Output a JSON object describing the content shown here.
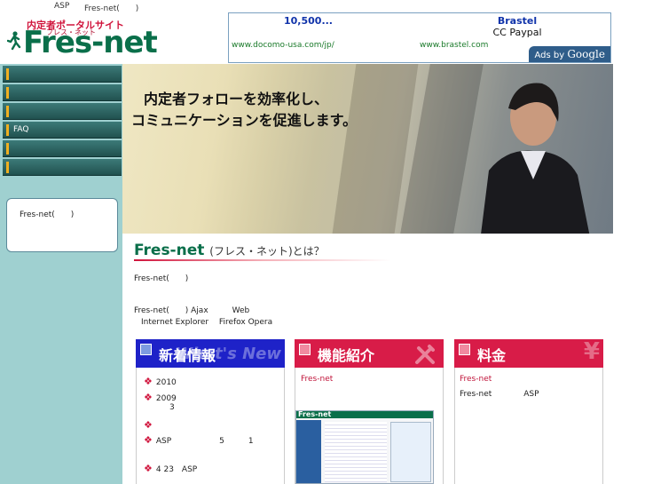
{
  "topbar": {
    "left": "ASP",
    "right": "Fres-net(　　)"
  },
  "logo": {
    "text": "Fres-net",
    "sub": "内定者ポータルサイト",
    "sub2": "フレス・ネット"
  },
  "ads": {
    "ad1": {
      "title": "10,500...",
      "desc": "",
      "url": "www.docomo-usa.com/jp/"
    },
    "ad2": {
      "title": "Brastel",
      "desc": "CC Paypal",
      "url": "www.brastel.com"
    },
    "adsby": "Ads by",
    "google": "Google"
  },
  "sidebar": {
    "items": [
      {
        "label": ""
      },
      {
        "label": ""
      },
      {
        "label": ""
      },
      {
        "label": "FAQ"
      },
      {
        "label": ""
      },
      {
        "label": ""
      }
    ],
    "box_text": "Fres-net(　　)"
  },
  "hero": {
    "line1": "内定者フォローを効率化し、",
    "line2": "コミュニケーションを促進します。"
  },
  "intro": {
    "title": "Fres-net",
    "title_jp": "(フレス・ネット)とは？",
    "p1": "Fres-net(　　)",
    "p2_line1": "Fres-net(　　) Ajax　　　Web",
    "p2_line2": "Internet Explorer　 Firefox Opera"
  },
  "panels": {
    "news": {
      "title": "新着情報",
      "bg": "What's New",
      "color": "#1e22c8",
      "items": [
        {
          "l1": "2010",
          "l2": ""
        },
        {
          "l1": "2009",
          "l2": "3"
        },
        {
          "l1": "",
          "l2": ""
        },
        {
          "l1": "ASP　　　　　　5　　　1",
          "l2": ""
        },
        {
          "l1": "4 23　ASP",
          "l2": ""
        }
      ]
    },
    "features": {
      "title": "機能紹介",
      "color": "#d81c48",
      "link": "Fres-net",
      "thumb_logo": "Fres-net"
    },
    "price": {
      "title": "料金",
      "bg": "¥",
      "color": "#d81c48",
      "link": "Fres-net",
      "line2": "Fres-net　　　　ASP"
    }
  }
}
